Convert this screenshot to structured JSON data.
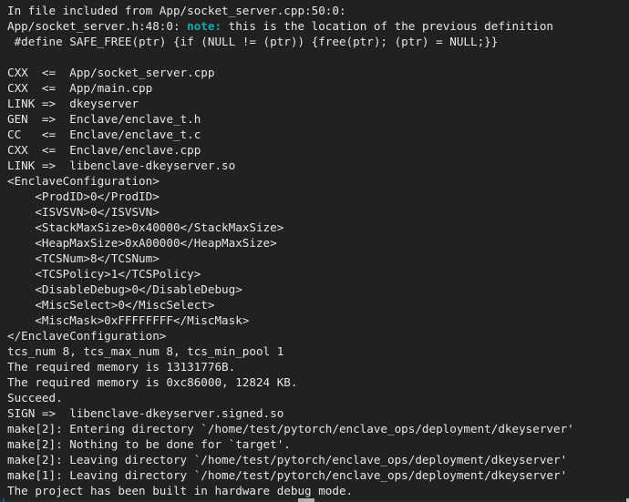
{
  "terminal": {
    "background_color": "#212121",
    "text_color": "#e6e6e6",
    "note_color": "#16a9a9",
    "left_stripe_color": "#1b2a3d",
    "right_stripe_color": "#b9bcc0",
    "lines": [
      {
        "text": "In file included from App/socket_server.cpp:50:0:"
      },
      {
        "pre": "App/socket_server.h:48:0: ",
        "note": "note:",
        "post": " this is the location of the previous definition"
      },
      {
        "text": " #define SAFE_FREE(ptr) {if (NULL != (ptr)) {free(ptr); (ptr) = NULL;}}"
      },
      {
        "text": ""
      },
      {
        "text": "CXX  <=  App/socket_server.cpp"
      },
      {
        "text": "CXX  <=  App/main.cpp"
      },
      {
        "text": "LINK =>  dkeyserver"
      },
      {
        "text": "GEN  =>  Enclave/enclave_t.h"
      },
      {
        "text": "CC   <=  Enclave/enclave_t.c"
      },
      {
        "text": "CXX  <=  Enclave/enclave.cpp"
      },
      {
        "text": "LINK =>  libenclave-dkeyserver.so"
      },
      {
        "text": "<EnclaveConfiguration>"
      },
      {
        "text": "    <ProdID>0</ProdID>"
      },
      {
        "text": "    <ISVSVN>0</ISVSVN>"
      },
      {
        "text": "    <StackMaxSize>0x40000</StackMaxSize>"
      },
      {
        "text": "    <HeapMaxSize>0xA00000</HeapMaxSize>"
      },
      {
        "text": "    <TCSNum>8</TCSNum>"
      },
      {
        "text": "    <TCSPolicy>1</TCSPolicy>"
      },
      {
        "text": "    <DisableDebug>0</DisableDebug>"
      },
      {
        "text": "    <MiscSelect>0</MiscSelect>"
      },
      {
        "text": "    <MiscMask>0xFFFFFFFF</MiscMask>"
      },
      {
        "text": "</EnclaveConfiguration>"
      },
      {
        "text": "tcs_num 8, tcs_max_num 8, tcs_min_pool 1"
      },
      {
        "text": "The required memory is 13131776B."
      },
      {
        "text": "The required memory is 0xc86000, 12824 KB."
      },
      {
        "text": "Succeed."
      },
      {
        "text": "SIGN =>  libenclave-dkeyserver.signed.so"
      },
      {
        "text": "make[2]: Entering directory `/home/test/pytorch/enclave_ops/deployment/dkeyserver'"
      },
      {
        "text": "make[2]: Nothing to be done for `target'."
      },
      {
        "text": "make[2]: Leaving directory `/home/test/pytorch/enclave_ops/deployment/dkeyserver'"
      },
      {
        "text": "make[1]: Leaving directory `/home/test/pytorch/enclave_ops/deployment/dkeyserver'"
      },
      {
        "text": "The project has been built in hardware debug mode."
      }
    ]
  }
}
